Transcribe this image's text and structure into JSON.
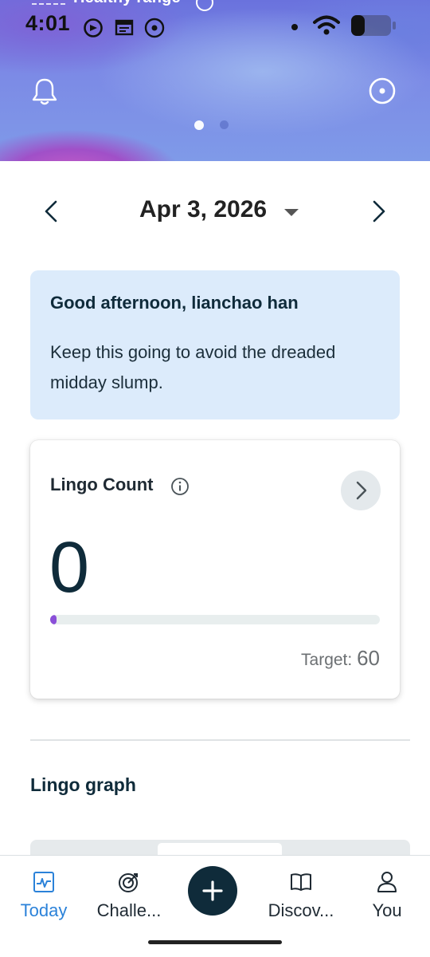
{
  "status_bar": {
    "time": "4:01",
    "icons": [
      "app-notification-icon",
      "calendar-icon",
      "record-icon",
      "dot",
      "wifi-icon",
      "battery-icon"
    ]
  },
  "hero": {
    "clipped_text": "Healthy range",
    "bell_icon": "bell-icon",
    "record_icon": "record-icon",
    "pager": {
      "pages": 2,
      "active": 1
    }
  },
  "date_nav": {
    "date": "Apr 3, 2026",
    "prev_icon": "chevron-left-icon",
    "next_icon": "chevron-right-icon",
    "dropdown_icon": "caret-down-icon"
  },
  "greeting": {
    "title": "Good afternoon, lianchao han",
    "body": "Keep this going to avoid the dreaded midday slump."
  },
  "lingo_card": {
    "title": "Lingo Count",
    "value": "0",
    "target_label": "Target:",
    "target_value": "60",
    "progress_fraction": 0,
    "accent_color": "#8a4fd8"
  },
  "graph_section": {
    "title": "Lingo graph"
  },
  "bottom_nav": {
    "items": [
      {
        "label": "Today",
        "icon": "activity-icon",
        "active": true
      },
      {
        "label": "Challe...",
        "icon": "target-icon",
        "active": false
      },
      {
        "label": "",
        "icon": "plus-icon",
        "active": false
      },
      {
        "label": "Discov...",
        "icon": "book-icon",
        "active": false
      },
      {
        "label": "You",
        "icon": "person-icon",
        "active": false
      }
    ],
    "active_color": "#2b82d9"
  }
}
